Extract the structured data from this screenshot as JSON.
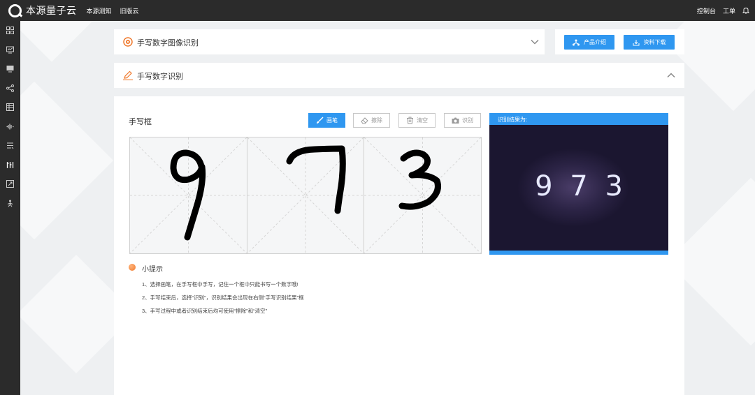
{
  "topbar": {
    "brand": "本源量子云",
    "nav": [
      "本源测知",
      "旧版云"
    ],
    "right": [
      "控制台",
      "工单"
    ]
  },
  "sidebar": {
    "icons": [
      "grid-icon",
      "monitor-chart-icon",
      "desktop-icon",
      "share-icon",
      "table-icon",
      "wave-icon",
      "list-icon",
      "columns-icon",
      "expand-icon",
      "person-icon"
    ]
  },
  "header1": {
    "title": "手写数字图像识别"
  },
  "header2": {
    "title": "手写数字识别"
  },
  "actions": {
    "intro": "产品介绍",
    "download": "资料下载"
  },
  "board": {
    "label": "手写框",
    "tools": {
      "pen": "画笔",
      "erase": "擦除",
      "clear": "清空",
      "recognize": "识别"
    },
    "digits": [
      "9",
      "7",
      "3"
    ]
  },
  "result": {
    "heading": "识别结果为:",
    "value": "9 7 3"
  },
  "tips": {
    "title": "小提示",
    "items": [
      "1、选择画笔，在手写框中手写，记住一个框中只能书写一个数字哦!",
      "2、手写结束后，选择“识别”，识别结果会出现在右侧“手写识别结果”框",
      "3、手写过程中或者识别结束后均可使用“擦除”和“清空”"
    ]
  },
  "colors": {
    "accent": "#2f97f0",
    "topbar": "#2b2b2b",
    "orange": "#f07a2e"
  }
}
